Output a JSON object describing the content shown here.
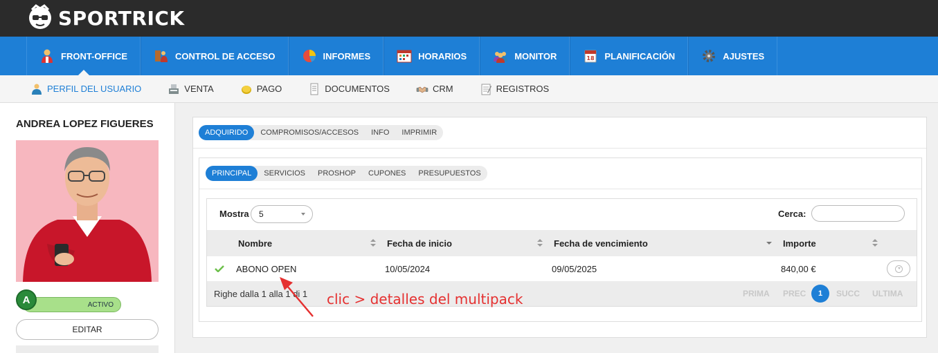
{
  "brand": {
    "name": "SPORTRICK"
  },
  "main_nav": [
    {
      "label": "FRONT-OFFICE",
      "icon": "user-icon",
      "active": true
    },
    {
      "label": "CONTROL DE ACCESO",
      "icon": "access-control-icon",
      "active": false
    },
    {
      "label": "INFORMES",
      "icon": "pie-chart-icon",
      "active": false
    },
    {
      "label": "HORARIOS",
      "icon": "calendar-grid-icon",
      "active": false
    },
    {
      "label": "MONITOR",
      "icon": "group-icon",
      "active": false
    },
    {
      "label": "PLANIFICACIÓN",
      "icon": "calendar-icon",
      "active": false
    },
    {
      "label": "AJUSTES",
      "icon": "gear-icon",
      "active": false
    }
  ],
  "sub_nav": [
    {
      "label": "PERFIL DEL USUARIO",
      "icon": "person-icon",
      "active": true
    },
    {
      "label": "VENTA",
      "icon": "cash-register-icon",
      "active": false
    },
    {
      "label": "PAGO",
      "icon": "coin-icon",
      "active": false
    },
    {
      "label": "DOCUMENTOS",
      "icon": "document-icon",
      "active": false
    },
    {
      "label": "CRM",
      "icon": "handshake-icon",
      "active": false
    },
    {
      "label": "REGISTROS",
      "icon": "notepad-icon",
      "active": false
    }
  ],
  "user": {
    "name": "ANDREA LOPEZ FIGUERES",
    "status_letter": "A",
    "status": "ACTIVO",
    "edit_label": "EDITAR"
  },
  "outer_tabs": [
    {
      "label": "ADQUIRIDO",
      "active": true
    },
    {
      "label": "COMPROMISOS/ACCESOS",
      "active": false
    },
    {
      "label": "INFO",
      "active": false
    },
    {
      "label": "IMPRIMIR",
      "active": false
    }
  ],
  "inner_tabs": [
    {
      "label": "PRINCIPAL",
      "active": true
    },
    {
      "label": "SERVICIOS",
      "active": false
    },
    {
      "label": "PROSHOP",
      "active": false
    },
    {
      "label": "CUPONES",
      "active": false
    },
    {
      "label": "PRESUPUESTOS",
      "active": false
    }
  ],
  "table": {
    "show_label": "Mostra",
    "show_value": "5",
    "search_label": "Cerca:",
    "search_value": "",
    "columns": [
      "Nombre",
      "Fecha de inicio",
      "Fecha de vencimiento",
      "Importe"
    ],
    "rows": [
      {
        "nombre": "ABONO OPEN",
        "fecha_inicio": "10/05/2024",
        "fecha_vencimiento": "09/05/2025",
        "importe": "840,00 €",
        "status_icon": "check-icon"
      }
    ],
    "footer_info": "Righe dalla 1 alla 1 di 1",
    "pager": {
      "first": "PRIMA",
      "prev": "PREC",
      "current": "1",
      "next": "SUCC",
      "last": "ULTIMA"
    }
  },
  "annotation": {
    "text": "clic > detalles del multipack",
    "color": "#e53030"
  },
  "colors": {
    "accent": "#1e7fd6",
    "topbar": "#2b2b2b",
    "status_green": "#a8e08a"
  }
}
